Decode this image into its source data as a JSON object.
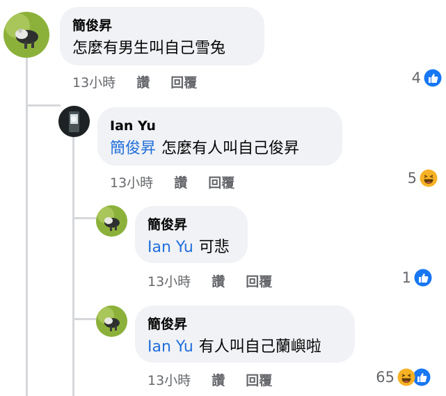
{
  "comments": [
    {
      "author": "簡俊昇",
      "mention": "",
      "text": "怎麼有男生叫自己雪兔",
      "time": "13小時",
      "like": "讚",
      "reply": "回覆",
      "reaction_count": "4",
      "reactions": [
        "like-icon"
      ]
    },
    {
      "author": "Ian Yu",
      "mention": "簡俊昇",
      "text": "怎麼有人叫自己俊昇",
      "time": "13小時",
      "like": "讚",
      "reply": "回覆",
      "reaction_count": "5",
      "reactions": [
        "haha-icon"
      ]
    },
    {
      "author": "簡俊昇",
      "mention": "Ian Yu",
      "text": "可悲",
      "time": "13小時",
      "like": "讚",
      "reply": "回覆",
      "reaction_count": "1",
      "reactions": [
        "like-icon"
      ]
    },
    {
      "author": "簡俊昇",
      "mention": "Ian Yu",
      "text": "有人叫自己蘭嶼啦",
      "time": "13小時",
      "like": "讚",
      "reply": "回覆",
      "reaction_count": "65",
      "reactions": [
        "haha-icon",
        "like-icon"
      ]
    }
  ],
  "colors": {
    "bubble": "#f0f2f5",
    "mention": "#216fdb",
    "like_blue": "#1877f2",
    "haha_yellow": "#f7b125",
    "meta_gray": "#65676b"
  }
}
